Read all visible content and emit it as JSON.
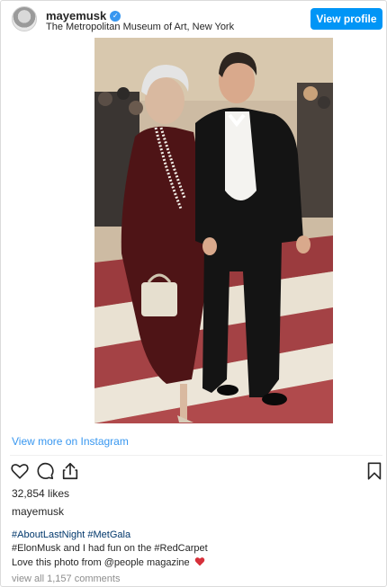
{
  "header": {
    "username": "mayemusk",
    "location": "The Metropolitan Museum of Art, New York",
    "view_profile_label": "View profile"
  },
  "post": {
    "view_more_label": "View more on Instagram",
    "likes": "32,854 likes",
    "caption_username": "mayemusk",
    "caption_line1": "#AboutLastNight #MetGala",
    "caption_line2": "#ElonMusk and I had fun on the #RedCarpet",
    "caption_line3": "Love this photo from @people magazine",
    "comments_label": "view all 1,157 comments"
  },
  "icons": [
    "heart-icon",
    "comment-icon",
    "share-icon",
    "bookmark-icon",
    "verified-icon"
  ],
  "colors": {
    "accent": "#0095f6",
    "link": "#3897f0",
    "hashtag": "#00376b",
    "muted": "#8e8e8e"
  }
}
